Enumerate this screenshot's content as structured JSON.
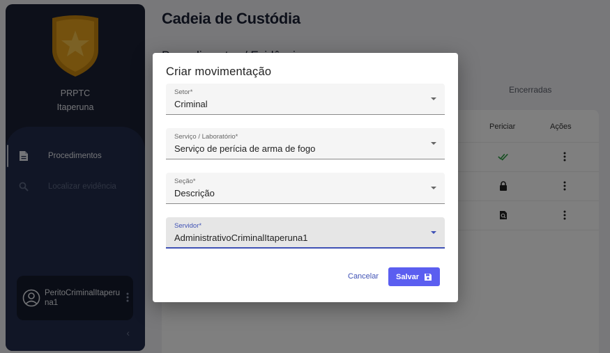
{
  "sidebar": {
    "org_line1": "PRPTC",
    "org_line2": "Itaperuna",
    "nav": [
      {
        "label": "Procedimentos",
        "icon": "document-icon",
        "active": true
      },
      {
        "label": "Localizar evidência",
        "icon": "search-icon",
        "active": false
      }
    ],
    "user": {
      "name": "PeritoCriminalItaperuna1"
    }
  },
  "header": {
    "title": "Cadeia de Custódia",
    "subtitle": "Procedimentos / Evidências"
  },
  "tabs": {
    "closed_label": "Encerradas"
  },
  "table": {
    "columns": [
      "Periciar",
      "Ações"
    ],
    "rows": [
      {
        "status_icon": "double-check-icon"
      },
      {
        "status_icon": "lock-icon"
      },
      {
        "status_icon": "search-document-icon"
      }
    ]
  },
  "dialog": {
    "title": "Criar movimentação",
    "fields": [
      {
        "label": "Setor*",
        "value": "Criminal"
      },
      {
        "label": "Serviço / Laboratório*",
        "value": "Serviço de perícia de arma de fogo"
      },
      {
        "label": "Seção*",
        "value": "Descrição"
      },
      {
        "label": "Servidor*",
        "value": "AdministrativoCriminalItaperuna1"
      }
    ],
    "cancel_label": "Cancelar",
    "save_label": "Salvar"
  },
  "colors": {
    "sidebar_bg": "#1a2035",
    "sidebar_nav_bg": "#232c4c",
    "accent": "#5b5ef0",
    "focus": "#3f51b5",
    "check_green": "#2e9e44",
    "badge_gold": "#e0a020"
  }
}
